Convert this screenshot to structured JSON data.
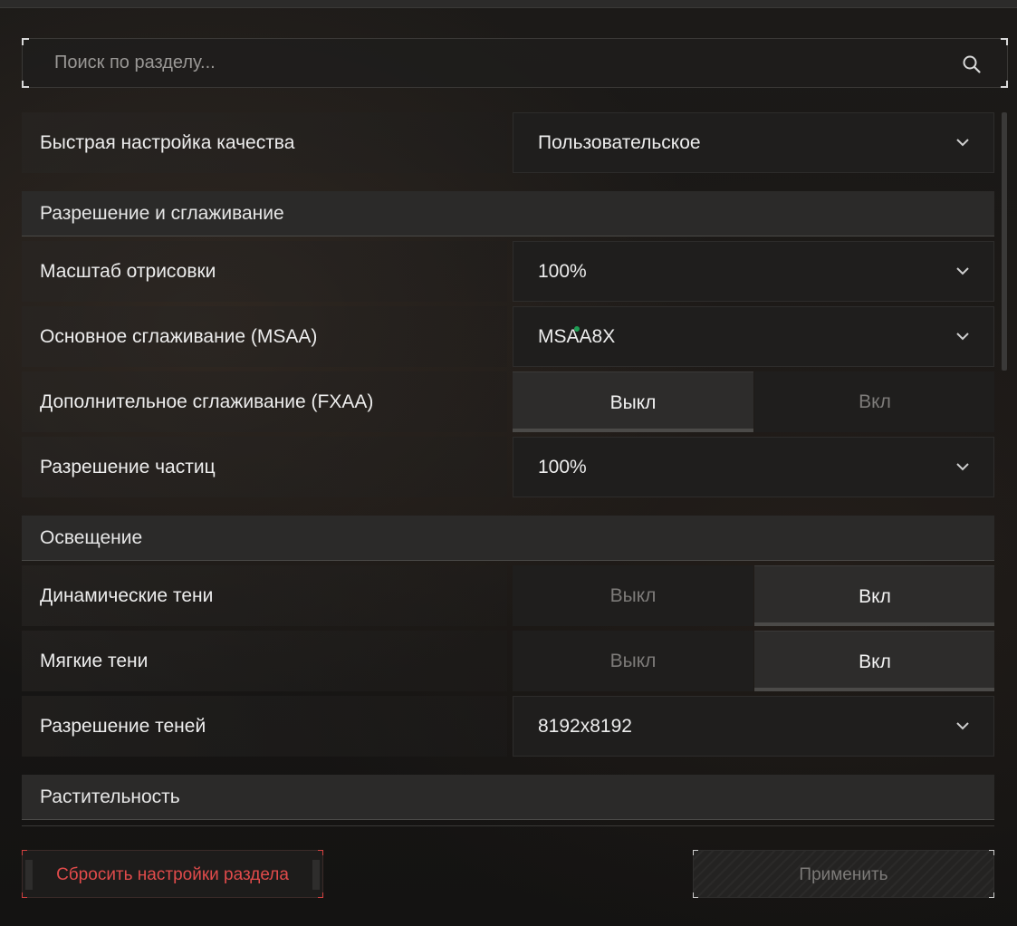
{
  "search": {
    "placeholder": "Поиск по разделу...",
    "icon": "search-icon"
  },
  "quick_quality": {
    "label": "Быстрая настройка качества",
    "value": "Пользовательское"
  },
  "sections": {
    "resolution": "Разрешение и сглаживание",
    "lighting": "Освещение",
    "vegetation": "Растительность"
  },
  "render_scale": {
    "label": "Масштаб отрисовки",
    "value": "100%"
  },
  "msaa": {
    "label": "Основное сглаживание (MSAA)",
    "value": "MSAA8X"
  },
  "fxaa": {
    "label": "Дополнительное сглаживание (FXAA)",
    "off": "Выкл",
    "on": "Вкл",
    "selected": "Выкл"
  },
  "particle_res": {
    "label": "Разрешение частиц",
    "value": "100%"
  },
  "dynamic_shadows": {
    "label": "Динамические тени",
    "off": "Выкл",
    "on": "Вкл",
    "selected": "Вкл"
  },
  "soft_shadows": {
    "label": "Мягкие тени",
    "off": "Выкл",
    "on": "Вкл",
    "selected": "Вкл"
  },
  "shadow_res": {
    "label": "Разрешение теней",
    "value": "8192x8192"
  },
  "footer": {
    "reset_label": "Сбросить настройки раздела",
    "apply_label": "Применить"
  },
  "colors": {
    "reset_text": "#e14b4b",
    "status_dot": "#1f9e55",
    "background": "#161514"
  }
}
